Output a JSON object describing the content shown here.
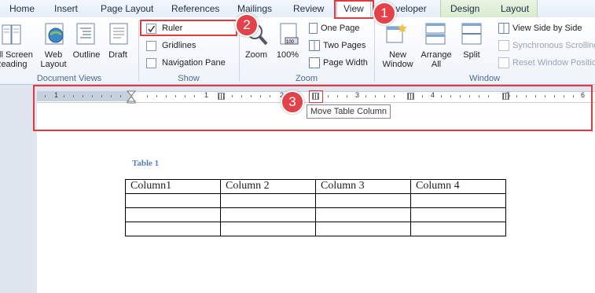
{
  "tabs": {
    "home": "Home",
    "insert": "Insert",
    "page_layout": "Page Layout",
    "references": "References",
    "mailings": "Mailings",
    "review": "Review",
    "view": "View",
    "developer": "Developer",
    "design": "Design",
    "layout": "Layout"
  },
  "ribbon": {
    "document_views": {
      "full_screen": "Full Screen\nReading",
      "web_layout": "Web\nLayout",
      "outline": "Outline",
      "draft": "Draft",
      "label": "Document Views"
    },
    "show": {
      "ruler": "Ruler",
      "ruler_checked": true,
      "gridlines": "Gridlines",
      "navigation_pane": "Navigation Pane",
      "label": "Show"
    },
    "zoom": {
      "zoom": "Zoom",
      "percent": "100%",
      "one_page": "One Page",
      "two_pages": "Two Pages",
      "page_width": "Page Width",
      "label": "Zoom"
    },
    "window": {
      "new_window": "New\nWindow",
      "arrange_all": "Arrange\nAll",
      "split": "Split",
      "view_side_by_side": "View Side by Side",
      "synchronous_scrolling": "Synchronous Scrolling",
      "reset_window_position": "Reset Window Position",
      "label": "Window"
    }
  },
  "ruler": {
    "numbers": [
      "1",
      "1",
      "2",
      "3",
      "4",
      "5",
      "6"
    ]
  },
  "tooltip": "Move Table Column",
  "annotations": [
    "1",
    "2",
    "3"
  ],
  "document": {
    "caption": "Table 1",
    "headers": [
      "Column1",
      "Column 2",
      "Column 3",
      "Column 4"
    ],
    "empty_rows": 3
  },
  "colors": {
    "annotation_red": "#e0393e",
    "caption_blue": "#4f81bd"
  }
}
